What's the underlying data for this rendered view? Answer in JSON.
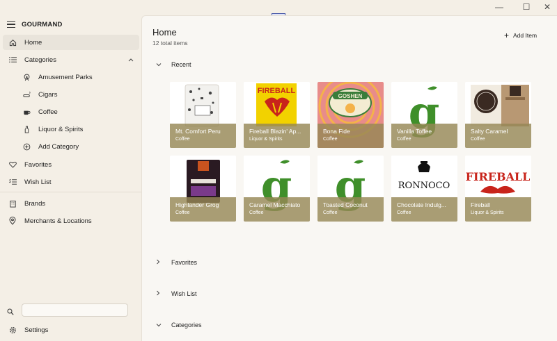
{
  "app": {
    "title": "GOURMAND"
  },
  "window_controls": {
    "minimize": "—",
    "maximize": "☐",
    "close": "✕"
  },
  "sidebar": {
    "items": [
      {
        "label": "Home",
        "icon": "home-icon",
        "active": true
      },
      {
        "label": "Categories",
        "icon": "list-icon",
        "expanded": true
      },
      {
        "label": "Amusement Parks",
        "icon": "ferris-wheel-icon",
        "sub": true
      },
      {
        "label": "Cigars",
        "icon": "cigar-icon",
        "sub": true
      },
      {
        "label": "Coffee",
        "icon": "coffee-cup-icon",
        "sub": true
      },
      {
        "label": "Liquor & Spirits",
        "icon": "bottle-icon",
        "sub": true
      },
      {
        "label": "Add Category",
        "icon": "add-circle-icon",
        "sub": true
      },
      {
        "label": "Favorites",
        "icon": "heart-icon"
      },
      {
        "label": "Wish List",
        "icon": "checklist-icon"
      },
      {
        "label": "Brands",
        "icon": "building-icon"
      },
      {
        "label": "Merchants & Locations",
        "icon": "location-pin-icon"
      }
    ],
    "search": {
      "value": "",
      "placeholder": ""
    },
    "settings_label": "Settings"
  },
  "main": {
    "title": "Home",
    "total": "12 total items",
    "add_item_label": "Add Item",
    "sections": {
      "recent": "Recent",
      "favorites": "Favorites",
      "wishlist": "Wish List",
      "categories": "Categories"
    },
    "cards": [
      {
        "name": "Mt. Comfort Peru",
        "category": "Coffee",
        "image": "coffee-bag-icon",
        "bg": "#ffffff",
        "fg": "#2a2a2a"
      },
      {
        "name": "Fireball Blazin' Ap...",
        "category": "Liquor & Spirits",
        "image": "fireball-dragon-icon",
        "bg": "#f2d200",
        "fg": "#c8241b",
        "logo": "FIREBALL"
      },
      {
        "name": "Bona Fide",
        "category": "Coffee",
        "image": "goshen-badge-icon",
        "bg": "#e88c8a",
        "fg": "#3a7d3a",
        "logo": "GOSHEN"
      },
      {
        "name": "Vanilla Toffee",
        "category": "Coffee",
        "image": "g-letter-icon",
        "bg": "#ffffff",
        "fg": "#3f8f2a",
        "logo": "g"
      },
      {
        "name": "Salty Caramel",
        "category": "Coffee",
        "image": "smoky-bag-icon",
        "bg": "#ffffff",
        "fg": "#5a3a2a"
      },
      {
        "name": "Highlander Grog",
        "category": "Coffee",
        "image": "ronnoco-bag-icon",
        "bg": "#ffffff",
        "fg": "#3a1f2a"
      },
      {
        "name": "Caramel Macchiato",
        "category": "Coffee",
        "image": "g-letter-icon",
        "bg": "#ffffff",
        "fg": "#3f8f2a",
        "logo": "g"
      },
      {
        "name": "Toasted Coconut",
        "category": "Coffee",
        "image": "g-letter-icon",
        "bg": "#ffffff",
        "fg": "#3f8f2a",
        "logo": "g"
      },
      {
        "name": "Chocolate Indulg...",
        "category": "Coffee",
        "image": "ronnoco-logo-icon",
        "bg": "#ffffff",
        "fg": "#111111",
        "logo": "RONNOCO"
      },
      {
        "name": "Fireball",
        "category": "Liquor & Spirits",
        "image": "fireball-logo-icon",
        "bg": "#ffffff",
        "fg": "#c8241b",
        "logo": "FIREBALL"
      }
    ]
  },
  "colors": {
    "accent_overlay": "#968755",
    "sidebar_bg": "#f4efe6",
    "main_bg": "#f9f7f3"
  }
}
